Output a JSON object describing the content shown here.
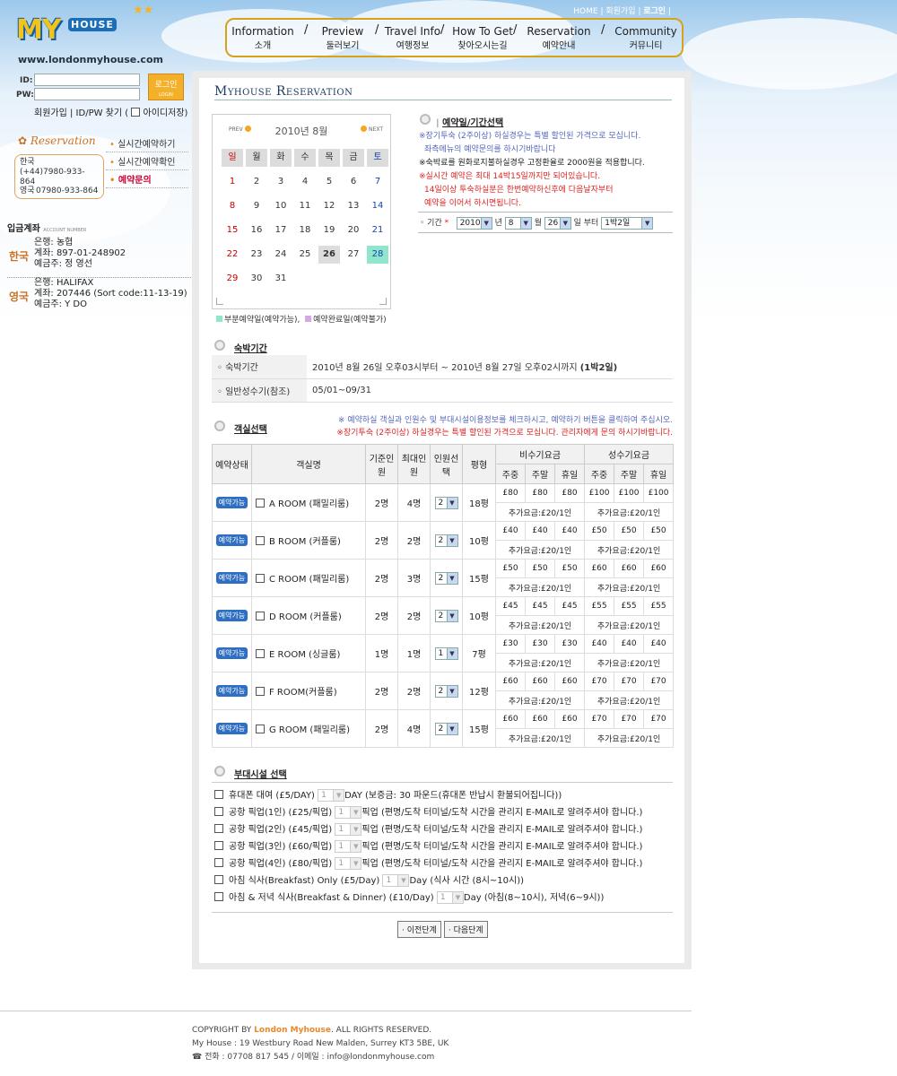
{
  "top_links": {
    "home": "HOME",
    "join": "회원가입",
    "login": "로그인"
  },
  "logo": {
    "my": "MY",
    "house": "HOUSE",
    "url": "www.londonmyhouse.com"
  },
  "nav": [
    {
      "en": "Information",
      "ko": "소개"
    },
    {
      "en": "Preview",
      "ko": "둘러보기"
    },
    {
      "en": "Travel Info",
      "ko": "여행정보"
    },
    {
      "en": "How To Get",
      "ko": "찾아오시는길"
    },
    {
      "en": "Reservation",
      "ko": "예약안내"
    },
    {
      "en": "Community",
      "ko": "커뮤니티"
    }
  ],
  "login": {
    "id_label": "ID:",
    "pw_label": "PW:",
    "button": "로그인",
    "button_sub": "LOGIN",
    "join": "회원가입",
    "find": "ID/PW 찾기",
    "save": "아이디저장"
  },
  "side": {
    "title": "Reservation",
    "phone": {
      "kr_label": "한국",
      "kr": "(+44)7980-933-864",
      "uk_label": "영국",
      "uk": "07980-933-864"
    },
    "menu": [
      "실시간예약하기",
      "실시간예약확인",
      "예약문의"
    ]
  },
  "bank": {
    "title": "입금계좌",
    "title_sub": "ACCOUNT NUMBER",
    "kr": {
      "country": "한국",
      "bank": "은행: 농협",
      "account": "계좌: 897-01-248902",
      "holder": "예금주: 정 영선"
    },
    "uk": {
      "country": "영국",
      "bank": "은행: HALIFAX",
      "account": "계좌: 207446 (Sort code:11-13-19)",
      "holder": "예금주: Y DO"
    }
  },
  "page_title": "Myhouse Reservation",
  "calendar": {
    "prev": "PREV",
    "next": "NEXT",
    "month": "2010년 8월",
    "dow": [
      "일",
      "월",
      "화",
      "수",
      "목",
      "금",
      "토"
    ],
    "weeks": [
      [
        "1",
        "2",
        "3",
        "4",
        "5",
        "6",
        "7"
      ],
      [
        "8",
        "9",
        "10",
        "11",
        "12",
        "13",
        "14"
      ],
      [
        "15",
        "16",
        "17",
        "18",
        "19",
        "20",
        "21"
      ],
      [
        "22",
        "23",
        "24",
        "25",
        "26",
        "27",
        "28"
      ],
      [
        "29",
        "30",
        "31",
        "",
        "",
        "",
        ""
      ]
    ],
    "today": "26",
    "partial_day": "28",
    "legend_partial": "부분예약일(예약가능),",
    "legend_full": "예약완료일(예약불가)",
    "colors": {
      "partial": "#8fe6cd",
      "full": "#d4a8e0"
    }
  },
  "date_section": {
    "title": "예약일/기간선택",
    "notes": [
      {
        "text": "※장기투숙 (2주이상) 하실경우는 특별 할인된 가격으로 모십니다.",
        "color": "blue"
      },
      {
        "text": "좌측메뉴의 예약문의를 하시기바랍니다",
        "color": "blue"
      },
      {
        "text": "※숙박료를 원화로지불하실경우 고정환율로 2000원을 적용합니다.",
        "color": "dark"
      },
      {
        "text": "※실시간 예약은 최대 14박15일까지만 되어있습니다.",
        "color": "red"
      },
      {
        "text": "14일이상 투숙하실분은 한번예약하신후에 다음날자부터",
        "color": "red"
      },
      {
        "text": "예약을 이어서 하시면됩니다.",
        "color": "red"
      }
    ],
    "period_label": "기간",
    "year": "2010",
    "year_unit": "년",
    "month": "8",
    "month_unit": "월",
    "day": "26",
    "day_unit": "일 부터",
    "nights": "1박2일"
  },
  "stay": {
    "title": "숙박기간",
    "rows": [
      {
        "label": "숙박기간",
        "value": "2010년 8월 26일 오후03시부터 ~ 2010년 8월 27일 오후02시까지",
        "strong": "(1박2일)"
      },
      {
        "label": "일반성수기(참조)",
        "value": "05/01~09/31",
        "strong": ""
      }
    ]
  },
  "rooms": {
    "title": "객실선택",
    "notes": [
      {
        "text": "※ 예약하실 객실과 인원수 및 부대시설이용정보를 체크하시고, 예약하기 버튼을 클릭하여 주십시오.",
        "color": "blue"
      },
      {
        "text": "※장기투숙 (2주이상) 하실경우는 특별 할인된 가격으로 모십니다. 관리자에게 문의 하시기바랍니다.",
        "color": "red"
      }
    ],
    "headers": {
      "status": "예약상태",
      "name": "객실명",
      "base": "기준인원",
      "max": "최대인원",
      "select": "인원선택",
      "area": "평형",
      "off": "비수기요금",
      "peak": "성수기요금",
      "weekday": "주중",
      "weekend": "주말",
      "holiday": "휴일"
    },
    "badge": "예약가능",
    "extra_label": "추가요금:£20/1인",
    "list": [
      {
        "name": "A ROOM (패밀리룸)",
        "base": "2명",
        "max": "4명",
        "sel": "2",
        "area": "18평",
        "off": [
          "£80",
          "£80",
          "£80"
        ],
        "peak": [
          "£100",
          "£100",
          "£100"
        ]
      },
      {
        "name": "B ROOM (커플룸)",
        "base": "2명",
        "max": "2명",
        "sel": "2",
        "area": "10평",
        "off": [
          "£40",
          "£40",
          "£40"
        ],
        "peak": [
          "£50",
          "£50",
          "£50"
        ]
      },
      {
        "name": "C ROOM (패밀리룸)",
        "base": "2명",
        "max": "3명",
        "sel": "2",
        "area": "15평",
        "off": [
          "£50",
          "£50",
          "£50"
        ],
        "peak": [
          "£60",
          "£60",
          "£60"
        ]
      },
      {
        "name": "D ROOM (커플룸)",
        "base": "2명",
        "max": "2명",
        "sel": "2",
        "area": "10평",
        "off": [
          "£45",
          "£45",
          "£45"
        ],
        "peak": [
          "£55",
          "£55",
          "£55"
        ]
      },
      {
        "name": "E ROOM (싱글룸)",
        "base": "1명",
        "max": "1명",
        "sel": "1",
        "area": "7평",
        "off": [
          "£30",
          "£30",
          "£30"
        ],
        "peak": [
          "£40",
          "£40",
          "£40"
        ]
      },
      {
        "name": "F ROOM(커플룸)",
        "base": "2명",
        "max": "2명",
        "sel": "2",
        "area": "12평",
        "off": [
          "£60",
          "£60",
          "£60"
        ],
        "peak": [
          "£70",
          "£70",
          "£70"
        ]
      },
      {
        "name": "G ROOM (패밀리룸)",
        "base": "2명",
        "max": "4명",
        "sel": "2",
        "area": "15평",
        "off": [
          "£60",
          "£60",
          "£60"
        ],
        "peak": [
          "£70",
          "£70",
          "£70"
        ]
      }
    ]
  },
  "facilities": {
    "title": "부대시설 선택",
    "sel_value": "1",
    "items": [
      {
        "label": "휴대폰 대여 (£5/DAY)",
        "after": "DAY (보증금: 30 파운드(휴대폰 반납시 환불되어집니다))"
      },
      {
        "label": "공항 픽업(1인) (£25/픽업)",
        "after": "픽업 (편명/도착 터미널/도착 시간을 관리지 E-MAIL로 알려주셔야 합니다.)"
      },
      {
        "label": "공항 픽업(2인) (£45/픽업)",
        "after": "픽업 (편명/도착 터미널/도착 시간을 관리지 E-MAIL로 알려주셔야 합니다.)"
      },
      {
        "label": "공항 픽업(3인) (£60/픽업)",
        "after": "픽업 (편명/도착 터미널/도착 시간을 관리지 E-MAIL로 알려주셔야 합니다.)"
      },
      {
        "label": "공항 픽업(4인) (£80/픽업)",
        "after": "픽업 (편명/도착 터미널/도착 시간을 관리지 E-MAIL로 알려주셔야 합니다.)"
      },
      {
        "label": "아침 식사(Breakfast) Only (£5/Day)",
        "after": "Day (식사 시간 (8시~10시))"
      },
      {
        "label": "아침 & 저녁 식사(Breakfast & Dinner) (£10/Day)",
        "after": "Day (아침(8~10시), 저녁(6~9시))"
      }
    ]
  },
  "buttons": {
    "prev": "· 이전단계",
    "next": "· 다음단계"
  },
  "footer": {
    "copy_pre": "COPYRIGHT BY ",
    "copy_brand": "London Myhouse",
    "copy_post": ". ALL RIGHTS RESERVED.",
    "address": "My House : 19 Westbury Road New Malden, Surrey KT3 5BE, UK",
    "contact": "☎ 전화 : 07708 817 545 / 이메일 : info@londonmyhouse.com"
  }
}
